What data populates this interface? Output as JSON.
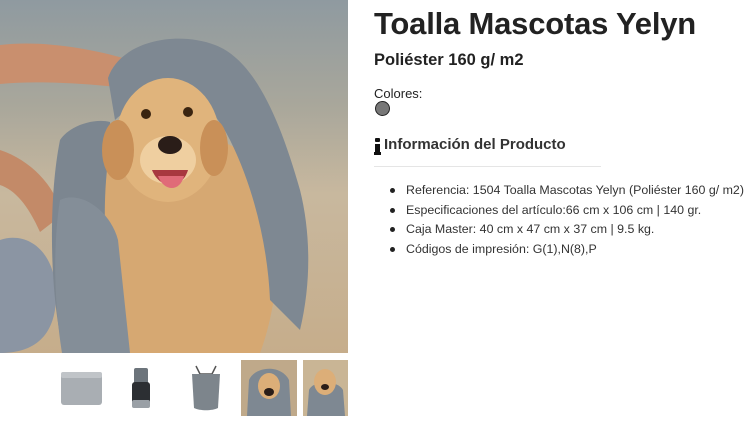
{
  "gallery": {
    "main_image": "golden-retriever-with-grey-towel-photo",
    "thumbnails": [
      "folded-towel-thumbnail",
      "rolled-towel-thumbnail",
      "towel-pouch-thumbnail",
      "dog-with-towel-thumbnail",
      "dog-portrait-thumbnail"
    ]
  },
  "product": {
    "title": "Toalla Mascotas Yelyn",
    "subtitle": "Poliéster 160 g/ m2",
    "colors_label": "Colores:",
    "colors": [
      "#777777"
    ]
  },
  "section": {
    "icon": "info-icon",
    "title": "Información del Producto"
  },
  "details": [
    "Referencia: 1504 Toalla Mascotas Yelyn (Poliéster 160 g/ m2)",
    "Especificaciones del artículo:66 cm x 106 cm | 140 gr.",
    "Caja Master: 40 cm x 47 cm x 37 cm | 9.5 kg.",
    "Códigos de impresión: G(1),N(8),P"
  ]
}
